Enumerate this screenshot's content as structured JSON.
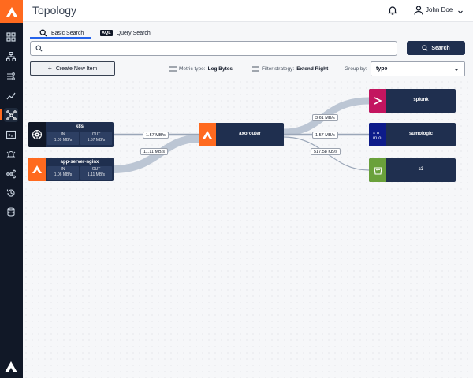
{
  "header": {
    "title": "Topology",
    "user_name": "John Doe"
  },
  "tabs": [
    {
      "label": "Basic Search",
      "active": true
    },
    {
      "label": "Query Search",
      "badge": "AQL"
    }
  ],
  "search": {
    "value": "",
    "placeholder": "",
    "button_label": "Search"
  },
  "toolbar": {
    "create_label": "Create New Item",
    "metric_label": "Metric type:",
    "metric_value": "Log Bytes",
    "filter_label": "Filter strategy:",
    "filter_value": "Extend Right",
    "group_by_label": "Group by:",
    "group_by_value": "type"
  },
  "sidebar": {
    "items": [
      {
        "icon": "dashboard-icon"
      },
      {
        "icon": "hierarchy-icon"
      },
      {
        "icon": "pipeline-icon"
      },
      {
        "icon": "trend-icon"
      },
      {
        "icon": "topology-icon",
        "active": true
      },
      {
        "icon": "terminal-icon"
      },
      {
        "icon": "alert-bell-icon"
      },
      {
        "icon": "flow-icon"
      },
      {
        "icon": "history-icon"
      },
      {
        "icon": "database-icon"
      }
    ]
  },
  "topology": {
    "sources": [
      {
        "name": "k8s",
        "in_label": "IN",
        "in_value": "1.09 MB/s",
        "out_label": "OUT",
        "out_value": "1.57 MB/s",
        "icon": "kubernetes-icon"
      },
      {
        "name": "app-server-nginx",
        "in_label": "IN",
        "in_value": "1.06 MB/s",
        "out_label": "OUT",
        "out_value": "1.11 MB/s",
        "icon": "axoflow-icon"
      }
    ],
    "router": {
      "name": "axorouter",
      "icon": "axoflow-icon"
    },
    "destinations": [
      {
        "name": "splunk",
        "icon": "splunk-icon",
        "color": "#c3155f"
      },
      {
        "name": "sumologic",
        "icon": "sumologic-icon",
        "color": "#0d1b8a"
      },
      {
        "name": "s3",
        "icon": "s3-bucket-icon",
        "color": "#6aa13b"
      }
    ],
    "edges": {
      "k8s_to_router": "1.57 MB/s",
      "nginx_to_router": "11.11 MB/s",
      "router_to_splunk": "3.61 MB/s",
      "router_to_sumologic": "1.57 MB/s",
      "router_to_s3": "517.58 KB/s"
    }
  },
  "colors": {
    "brand": "#ff6a1f",
    "node_bg": "#1f2f4f",
    "sidebar_bg": "#111827",
    "accent": "#2563eb"
  }
}
